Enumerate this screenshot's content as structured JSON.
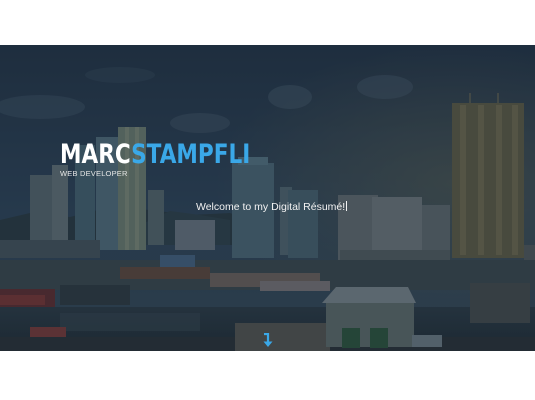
{
  "brand": {
    "first": "MARC",
    "last": "STAMPFLI",
    "tagline": "WEB DEVELOPER"
  },
  "hero": {
    "welcome_text": "Welcome to my Digital Résumé!",
    "scroll_icon": "arrow-down-icon"
  },
  "colors": {
    "accent": "#3aa8e8",
    "overlay": "#1a2836",
    "text": "#ffffff"
  }
}
